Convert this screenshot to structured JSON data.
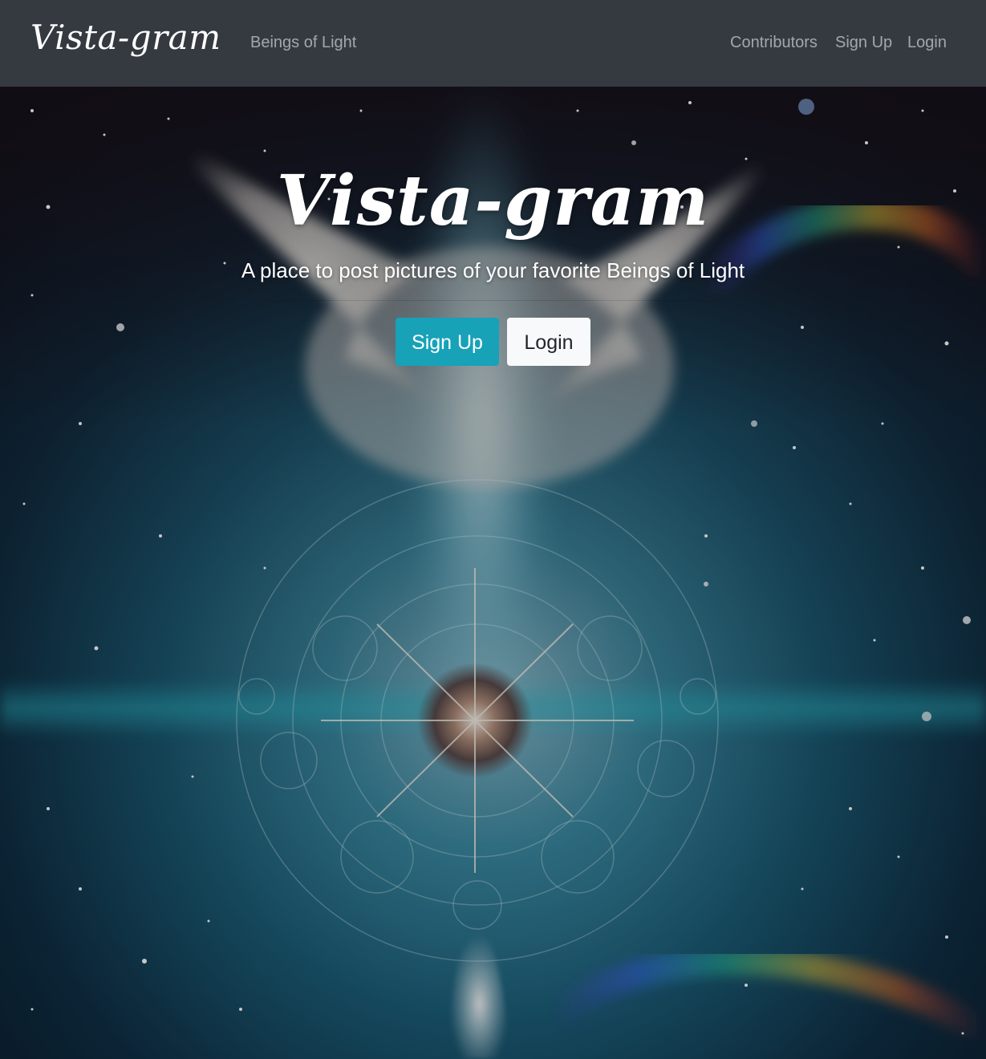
{
  "navbar": {
    "brand": "Vista-gram",
    "links": [
      {
        "label": "Beings of Light"
      },
      {
        "label": "Contributors"
      },
      {
        "label": "Sign Up"
      },
      {
        "label": "Login"
      }
    ]
  },
  "hero": {
    "title": "Vista-gram",
    "tagline": "A place to post pictures of your favorite Beings of Light",
    "signup_label": "Sign Up",
    "login_label": "Login"
  },
  "colors": {
    "navbar_bg": "#343a40",
    "primary_button": "#17a2b8",
    "light_button": "#f8f9fa",
    "nav_link": "rgba(255,255,255,0.55)"
  }
}
